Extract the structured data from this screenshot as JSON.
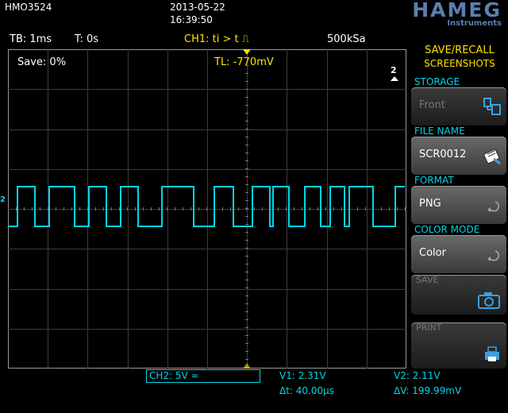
{
  "header": {
    "model": "HMO3524",
    "date": "2013-05-22",
    "time": "16:39:50",
    "brand": "HAMEG",
    "brand_sub": "Instruments"
  },
  "status": {
    "timebase": "TB: 1ms",
    "trigger_time": "T: 0s",
    "trigger": "CH1: ti > t ⎍",
    "sample_rate": "500kSa"
  },
  "screen": {
    "save_progress": "Save: 0%",
    "trigger_level": "TL:  -770mV",
    "channel_marker": "2",
    "signal_color": "#00d6e8"
  },
  "bottom": {
    "channel_setting": "CH2: 5V ≈",
    "v1": "V1: 2.31V",
    "delta_t": "Δt: 40.00µs",
    "v2": "V2: 2.11V",
    "delta_v": "ΔV: 199.99mV"
  },
  "menu": {
    "title_line1": "SAVE/RECALL",
    "title_line2": "SCREENSHOTS",
    "storage_label": "STORAGE",
    "storage_value": "Front",
    "file_name_label": "FILE NAME",
    "file_name_value": "SCR0012",
    "format_label": "FORMAT",
    "format_value": "PNG",
    "color_mode_label": "COLOR MODE",
    "color_mode_value": "Color",
    "save_label": "SAVE",
    "print_label": "PRINT"
  }
}
